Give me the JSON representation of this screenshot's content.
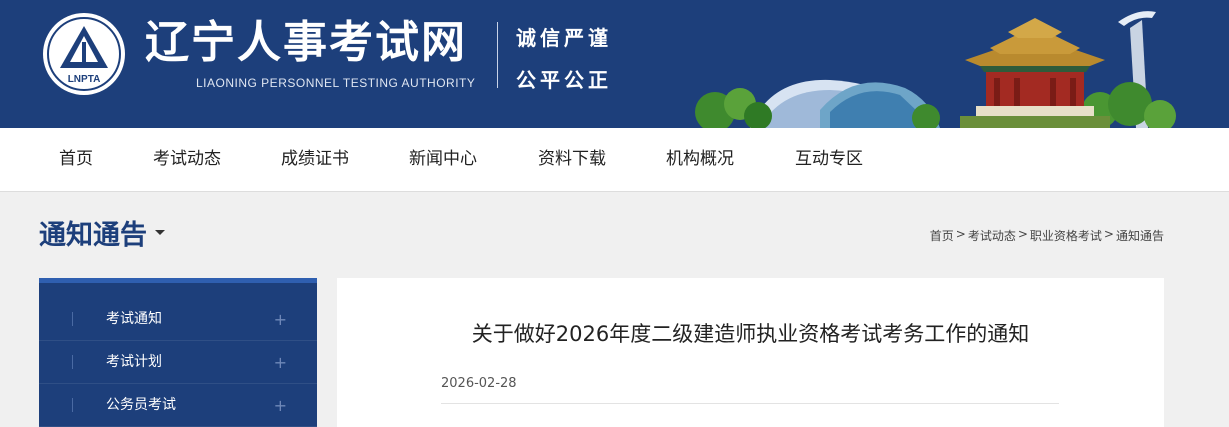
{
  "header": {
    "logo_text": "LNPTA",
    "site_title": "辽宁人事考试网",
    "site_subtitle": "LIAONING PERSONNEL TESTING AUTHORITY",
    "motto_line1": "诚信严谨",
    "motto_line2": "公平公正",
    "brand_color": "#1d3f7b"
  },
  "nav": {
    "items": [
      {
        "label": "首页"
      },
      {
        "label": "考试动态"
      },
      {
        "label": "成绩证书"
      },
      {
        "label": "新闻中心"
      },
      {
        "label": "资料下载"
      },
      {
        "label": "机构概况"
      },
      {
        "label": "互动专区"
      }
    ]
  },
  "page": {
    "heading": "通知通告",
    "breadcrumb": [
      "首页",
      "考试动态",
      "职业资格考试",
      "通知通告"
    ],
    "breadcrumb_separator": ">"
  },
  "sidebar": {
    "items": [
      {
        "label": "考试通知",
        "expand": "+"
      },
      {
        "label": "考试计划",
        "expand": "+"
      },
      {
        "label": "公务员考试",
        "expand": "+"
      }
    ]
  },
  "article": {
    "title": "关于做好2026年度二级建造师执业资格考试考务工作的通知",
    "date": "2026-02-28"
  }
}
